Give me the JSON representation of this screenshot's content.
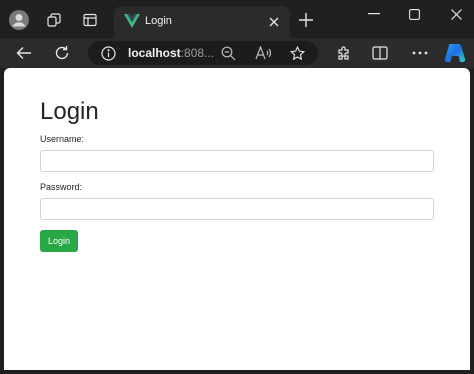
{
  "browser": {
    "tab": {
      "title": "Login"
    },
    "address": {
      "host": "localhost",
      "port_fragment": ":808..."
    }
  },
  "page": {
    "heading": "Login",
    "username": {
      "label": "Username:",
      "value": "",
      "placeholder": ""
    },
    "password": {
      "label": "Password:",
      "value": "",
      "placeholder": ""
    },
    "submit_label": "Login"
  },
  "colors": {
    "button": "#28a745",
    "chrome": "#202020",
    "vue_logo": "#41b883"
  }
}
